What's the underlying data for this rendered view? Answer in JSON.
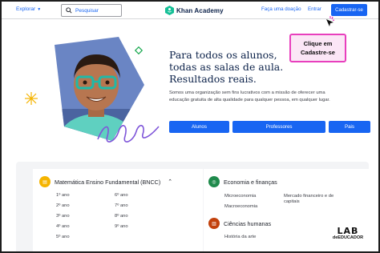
{
  "header": {
    "explore_label": "Explorar",
    "search_placeholder": "Pesquisar",
    "logo_text": "Khan Academy",
    "donate_label": "Faça uma doação",
    "login_label": "Entrar",
    "signup_label": "Cadastrar-se"
  },
  "hero": {
    "headline_line1": "Para todos os alunos,",
    "headline_line2": "todas as salas de aula.",
    "headline_line3": "Resultados reais.",
    "mission_text": "Somos uma organização sem fins lucrativos com a missão de oferecer uma educação gratuita de alta qualidade para qualquer pessoa, em qualquer lugar.",
    "buttons": [
      "Alunos",
      "Professores",
      "Pais"
    ]
  },
  "callout": {
    "line1": "Clique em",
    "line2": "Cadastre-se"
  },
  "subjects": {
    "math": {
      "title": "Matemática Ensino Fundamental (BNCC)",
      "col1": [
        "1º ano",
        "2º ano",
        "3º ano",
        "4º ano",
        "5º ano"
      ],
      "col2": [
        "6º ano",
        "7º ano",
        "8º ano",
        "9º ano"
      ]
    },
    "economy": {
      "title": "Economia e finanças",
      "col1": [
        "Microeconomia",
        "Macroeconomia"
      ],
      "col2": [
        "Mercado financeiro e de capitais"
      ]
    },
    "humanities": {
      "title": "Ciências humanas",
      "items": [
        "História da arte"
      ]
    }
  },
  "watermark": {
    "top": "LAB",
    "bottom": "deEDUCADOR"
  },
  "colors": {
    "brand_blue": "#1865f2",
    "callout_border": "#e83fbd",
    "logo_green": "#14bf96"
  }
}
